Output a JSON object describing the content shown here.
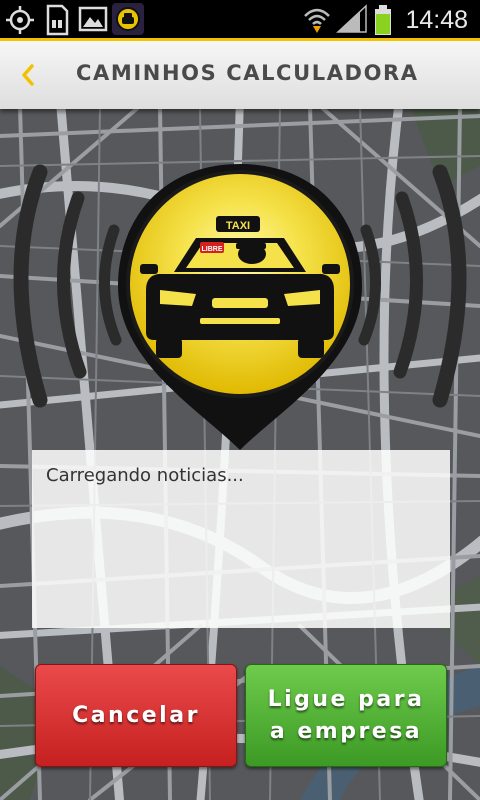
{
  "status_bar": {
    "time": "14:48",
    "icons": [
      "gps-icon",
      "sd-card-icon",
      "gallery-icon",
      "taxi-app-notification-icon",
      "wifi-icon",
      "signal-icon",
      "battery-icon"
    ]
  },
  "header": {
    "title": "CAMINHOS CALCULADORA",
    "back_icon": "chevron-left-icon"
  },
  "logo": {
    "sign_text": "TAXI",
    "badge_text": "LIBRE",
    "icon": "taxi-signal-icon"
  },
  "news": {
    "loading_text": "Carregando noticias..."
  },
  "buttons": {
    "cancel_label": "Cancelar",
    "call_line1": "Ligue para",
    "call_line2": "a empresa"
  },
  "colors": {
    "accent": "#f2c200",
    "cancel": "#d93333",
    "call": "#52b336",
    "map_road": "#b9bcc0",
    "map_block": "#57595c"
  }
}
